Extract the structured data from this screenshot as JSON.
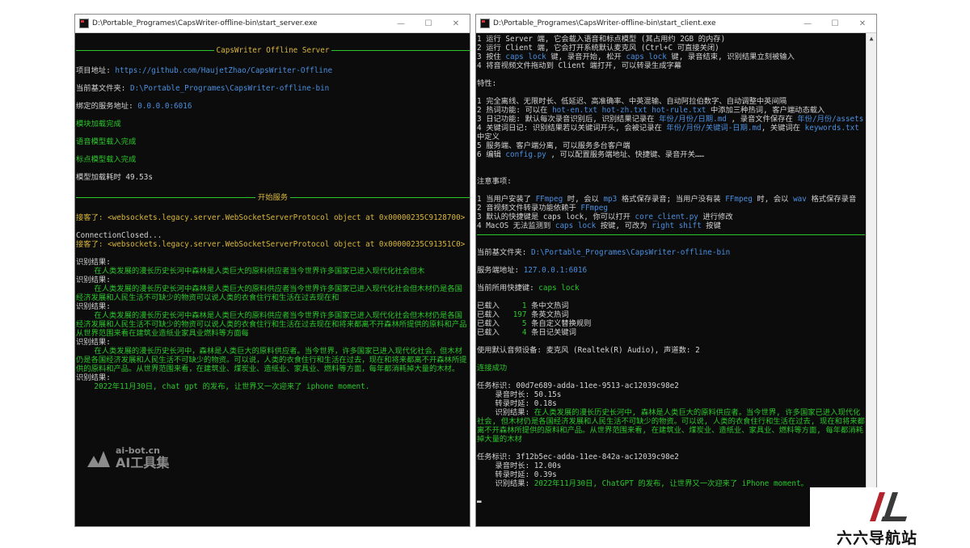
{
  "server_window": {
    "title": "D:\\Portable_Programes\\CapsWriter-offline-bin\\start_server.exe",
    "lines": [
      {
        "t": "gap"
      },
      {
        "t": "rule",
        "text": "CapsWriter Offline Server",
        "c": "y"
      },
      {
        "t": "gap"
      },
      {
        "t": "line",
        "segs": [
          {
            "text": "项目地址: ",
            "c": "w"
          },
          {
            "text": "https://github.com/HaujetZhao/CapsWriter-Offline",
            "c": "b"
          }
        ]
      },
      {
        "t": "gap"
      },
      {
        "t": "line",
        "segs": [
          {
            "text": "当前基文件夹: ",
            "c": "w"
          },
          {
            "text": "D:\\Portable_Programes\\CapsWriter-offline-bin",
            "c": "b"
          }
        ]
      },
      {
        "t": "gap"
      },
      {
        "t": "line",
        "segs": [
          {
            "text": "绑定的服务地址: ",
            "c": "w"
          },
          {
            "text": "0.0.0.0:6016",
            "c": "b"
          }
        ]
      },
      {
        "t": "gap"
      },
      {
        "t": "line",
        "segs": [
          {
            "text": "模块加载完成",
            "c": "g"
          }
        ]
      },
      {
        "t": "gap"
      },
      {
        "t": "line",
        "segs": [
          {
            "text": "语音模型载入完成",
            "c": "g"
          }
        ]
      },
      {
        "t": "gap"
      },
      {
        "t": "line",
        "segs": [
          {
            "text": "标点模型载入完成",
            "c": "g"
          }
        ]
      },
      {
        "t": "gap"
      },
      {
        "t": "line",
        "segs": [
          {
            "text": "模型加载耗时 49.53s",
            "c": "w"
          }
        ]
      },
      {
        "t": "gap"
      },
      {
        "t": "rule",
        "text": "开始服务",
        "c": "y"
      },
      {
        "t": "gap"
      },
      {
        "t": "line",
        "segs": [
          {
            "text": "接客了: <websockets.legacy.server.WebSocketServerProtocol object at 0x00000235C9128700>",
            "c": "y"
          }
        ]
      },
      {
        "t": "gap"
      },
      {
        "t": "line",
        "segs": [
          {
            "text": "ConnectionClosed...",
            "c": "w"
          }
        ]
      },
      {
        "t": "line",
        "segs": [
          {
            "text": "接客了: <websockets.legacy.server.WebSocketServerProtocol object at 0x00000235C91351C0>",
            "c": "y"
          }
        ]
      },
      {
        "t": "gap"
      },
      {
        "t": "line",
        "segs": [
          {
            "text": "识别结果:",
            "c": "w"
          }
        ]
      },
      {
        "t": "line",
        "segs": [
          {
            "text": "    在人类发展的漫长历史长河中森林是人类巨大的原料供应者当今世界许多国家已进入现代化社会但木",
            "c": "g"
          }
        ]
      },
      {
        "t": "line",
        "segs": [
          {
            "text": "识别结果:",
            "c": "w"
          }
        ]
      },
      {
        "t": "line",
        "segs": [
          {
            "text": "    在人类发展的漫长历史长河中森林是人类巨大的原料供应者当今世界许多国家已进入现代化社会但木材仍是各国经济发展和人民生活不可缺少的物资可以说人类的衣食住行和生活在过去现在和",
            "c": "g"
          }
        ]
      },
      {
        "t": "line",
        "segs": [
          {
            "text": "识别结果:",
            "c": "w"
          }
        ]
      },
      {
        "t": "line",
        "segs": [
          {
            "text": "    在人类发展的漫长历史长河中森林是人类巨大的原料供应者当今世界许多国家已进入现代化社会但木材仍是各国经济发展和人民生活不可缺少的物资可以说人类的衣食住行和生活在过去现在和将来都离不开森林所提供的原料和产品从世界范围来看在建筑业造纸业家具业燃料等方面每",
            "c": "g"
          }
        ]
      },
      {
        "t": "line",
        "segs": [
          {
            "text": "识别结果:",
            "c": "w"
          }
        ]
      },
      {
        "t": "line",
        "segs": [
          {
            "text": "    在人类发展的漫长历史长河中，森林是人类巨大的原料供应者。当今世界，许多国家已进入现代化社会，但木材仍是各国经济发展和人民生活不可缺少的物资。可以说，人类的衣食住行和生活在过去，现在和将来都离不开森林所提供的原料和产品。从世界范围来看，在建筑业、煤炭业、造纸业、家具业、燃料等方面，每年都消耗掉大量的木材。",
            "c": "g"
          }
        ]
      },
      {
        "t": "line",
        "segs": [
          {
            "text": "识别结果:",
            "c": "w"
          }
        ]
      },
      {
        "t": "line",
        "segs": [
          {
            "text": "    2022年11月30日, chat gpt 的发布, 让世界又一次迎来了 iphone moment.",
            "c": "g"
          }
        ]
      }
    ]
  },
  "client_window": {
    "title": "D:\\Portable_Programes\\CapsWriter-offline-bin\\start_client.exe",
    "lines": [
      {
        "t": "line",
        "segs": [
          {
            "text": "1 运行 Server 端, 它会载入语音和标点模型 (其占用约 2GB 的内存)",
            "c": "w"
          }
        ]
      },
      {
        "t": "line",
        "segs": [
          {
            "text": "2 运行 Client 端, 它会打开系统默认麦克风 (Ctrl+C 可直接关闭)",
            "c": "w"
          }
        ]
      },
      {
        "t": "line",
        "segs": [
          {
            "text": "3 按住 ",
            "c": "w"
          },
          {
            "text": "caps lock",
            "c": "b"
          },
          {
            "text": " 键, 录音开始, 松开 ",
            "c": "w"
          },
          {
            "text": "caps lock",
            "c": "b"
          },
          {
            "text": " 键, 录音结束, 识别结果立刻被输入",
            "c": "w"
          }
        ]
      },
      {
        "t": "line",
        "segs": [
          {
            "text": "4 将音视频文件拖动到 Client 端打开, 可以转录生成字幕",
            "c": "w"
          }
        ]
      },
      {
        "t": "gap"
      },
      {
        "t": "line",
        "segs": [
          {
            "text": "特性:",
            "c": "w"
          }
        ]
      },
      {
        "t": "gap"
      },
      {
        "t": "line",
        "segs": [
          {
            "text": "1 完全离线、无限时长、低延迟、高准确率、中英混输、自动阿拉伯数字、自动调整中英间隔",
            "c": "w"
          }
        ]
      },
      {
        "t": "line",
        "segs": [
          {
            "text": "2 热词功能: 可以在 ",
            "c": "w"
          },
          {
            "text": "hot-en.txt hot-zh.txt hot-rule.txt",
            "c": "b"
          },
          {
            "text": " 中添加三种热词, 客户端动态载入",
            "c": "w"
          }
        ]
      },
      {
        "t": "line",
        "segs": [
          {
            "text": "3 日记功能: 默认每次录音识别后, 识别结果记录在 ",
            "c": "w"
          },
          {
            "text": "年份/月份/日期.md",
            "c": "b"
          },
          {
            "text": " , 录音文件保存在 ",
            "c": "w"
          },
          {
            "text": "年份/月份/assets",
            "c": "b"
          }
        ]
      },
      {
        "t": "line",
        "segs": [
          {
            "text": "4 关键词日记: 识别结果若以关键词开头, 会被记录在 ",
            "c": "w"
          },
          {
            "text": "年份/月份/关键词-日期.md",
            "c": "b"
          },
          {
            "text": ", 关键词在 ",
            "c": "w"
          },
          {
            "text": "keywords.txt",
            "c": "b"
          },
          {
            "text": " 中定义",
            "c": "w"
          }
        ]
      },
      {
        "t": "line",
        "segs": [
          {
            "text": "5 服务端、客户端分离, 可以服务多台客户端",
            "c": "w"
          }
        ]
      },
      {
        "t": "line",
        "segs": [
          {
            "text": "6 编辑 ",
            "c": "w"
          },
          {
            "text": "config.py",
            "c": "b"
          },
          {
            "text": " , 可以配置服务端地址、快捷键、录音开关……",
            "c": "w"
          }
        ]
      },
      {
        "t": "gap2"
      },
      {
        "t": "line",
        "segs": [
          {
            "text": "注意事项:",
            "c": "w"
          }
        ]
      },
      {
        "t": "gap"
      },
      {
        "t": "line",
        "segs": [
          {
            "text": "1 当用户安装了 ",
            "c": "w"
          },
          {
            "text": "FFmpeg",
            "c": "b"
          },
          {
            "text": " 时, 会以 ",
            "c": "w"
          },
          {
            "text": "mp3",
            "c": "b"
          },
          {
            "text": " 格式保存录音; 当用户没有装 ",
            "c": "w"
          },
          {
            "text": "FFmpeg",
            "c": "b"
          },
          {
            "text": " 时, 会以 ",
            "c": "w"
          },
          {
            "text": "wav",
            "c": "b"
          },
          {
            "text": " 格式保存录音",
            "c": "w"
          }
        ]
      },
      {
        "t": "line",
        "segs": [
          {
            "text": "2 音视频文件转录功能依赖于 ",
            "c": "w"
          },
          {
            "text": "FFmpeg",
            "c": "b"
          }
        ]
      },
      {
        "t": "line",
        "segs": [
          {
            "text": "3 默认的快捷键是 caps lock, 你可以打开 ",
            "c": "w"
          },
          {
            "text": "core_client.py",
            "c": "b"
          },
          {
            "text": " 进行修改",
            "c": "w"
          }
        ]
      },
      {
        "t": "line",
        "segs": [
          {
            "text": "4 MacOS 无法监测到 ",
            "c": "w"
          },
          {
            "text": "caps lock",
            "c": "b"
          },
          {
            "text": " 按键, 可改为 ",
            "c": "w"
          },
          {
            "text": "right shift",
            "c": "b"
          },
          {
            "text": " 按键",
            "c": "w"
          }
        ]
      },
      {
        "t": "hr"
      },
      {
        "t": "gap"
      },
      {
        "t": "line",
        "segs": [
          {
            "text": "当前基文件夹: ",
            "c": "w"
          },
          {
            "text": "D:\\Portable_Programes\\CapsWriter-offline-bin",
            "c": "b"
          }
        ]
      },
      {
        "t": "gap"
      },
      {
        "t": "line",
        "segs": [
          {
            "text": "服务端地址: ",
            "c": "w"
          },
          {
            "text": "127.0.0.1:6016",
            "c": "b"
          }
        ]
      },
      {
        "t": "gap"
      },
      {
        "t": "line",
        "segs": [
          {
            "text": "当前所用快捷键: ",
            "c": "w"
          },
          {
            "text": "caps lock",
            "c": "g"
          }
        ]
      },
      {
        "t": "gap"
      },
      {
        "t": "line",
        "segs": [
          {
            "text": "已载入 ",
            "c": "w"
          },
          {
            "text": "    1",
            "c": "g"
          },
          {
            "text": " 条中文热词",
            "c": "w"
          }
        ]
      },
      {
        "t": "line",
        "segs": [
          {
            "text": "已载入 ",
            "c": "w"
          },
          {
            "text": "  197",
            "c": "g"
          },
          {
            "text": " 条英文热词",
            "c": "w"
          }
        ]
      },
      {
        "t": "line",
        "segs": [
          {
            "text": "已载入 ",
            "c": "w"
          },
          {
            "text": "    5",
            "c": "g"
          },
          {
            "text": " 条自定义替换规则",
            "c": "w"
          }
        ]
      },
      {
        "t": "line",
        "segs": [
          {
            "text": "已载入 ",
            "c": "w"
          },
          {
            "text": "    4",
            "c": "g"
          },
          {
            "text": " 条日记关键词",
            "c": "w"
          }
        ]
      },
      {
        "t": "gap"
      },
      {
        "t": "line",
        "segs": [
          {
            "text": "使用默认音频设备: 麦克风 (Realtek(R) Audio), 声道数: 2",
            "c": "w"
          }
        ]
      },
      {
        "t": "gap"
      },
      {
        "t": "line",
        "segs": [
          {
            "text": "连接成功",
            "c": "g"
          }
        ]
      },
      {
        "t": "gap"
      },
      {
        "t": "line",
        "segs": [
          {
            "text": "任务标识: 00d7e689-adda-11ee-9513-ac12039c98e2",
            "c": "w"
          }
        ]
      },
      {
        "t": "line",
        "segs": [
          {
            "text": "    录音时长: 50.15s",
            "c": "w"
          }
        ]
      },
      {
        "t": "line",
        "segs": [
          {
            "text": "    转录时延: 0.18s",
            "c": "w"
          }
        ]
      },
      {
        "t": "line",
        "segs": [
          {
            "text": "    识别结果: ",
            "c": "w"
          },
          {
            "text": "在人类发展的漫长历史长河中, 森林是人类巨大的原料供应者。当今世界, 许多国家已进入现代化社会, 但木材仍是各国经济发展和人民生活不可缺少的物资。可以说, 人类的衣食住行和生活在过去, 现在和将来都离不开森林所提供的原料和产品。从世界范围来看, 在建筑业、煤炭业、造纸业、家具业、燃料等方面, 每年都消耗掉大量的木材",
            "c": "g"
          }
        ]
      },
      {
        "t": "gap"
      },
      {
        "t": "line",
        "segs": [
          {
            "text": "任务标识: 3f12b5ec-adda-11ee-842a-ac12039c98e2",
            "c": "w"
          }
        ]
      },
      {
        "t": "line",
        "segs": [
          {
            "text": "    录音时长: 12.00s",
            "c": "w"
          }
        ]
      },
      {
        "t": "line",
        "segs": [
          {
            "text": "    转录时延: 0.39s",
            "c": "w"
          }
        ]
      },
      {
        "t": "line",
        "segs": [
          {
            "text": "    识别结果: ",
            "c": "w"
          },
          {
            "text": "2022年11月30日, ChatGPT 的发布, 让世界又一次迎来了 iPhone moment。",
            "c": "g"
          }
        ]
      },
      {
        "t": "gap"
      },
      {
        "t": "line",
        "segs": [
          {
            "text": "▬",
            "c": "w"
          }
        ]
      }
    ]
  },
  "watermark_left": {
    "line1": "ai-bot.cn",
    "line2": "AI工具集"
  },
  "watermark_right": {
    "label": "六六导航站"
  },
  "colors": {
    "white": "#d4d4d4",
    "green": "#2bc82b",
    "yellow": "#d9b73c",
    "blue": "#4a8fe0",
    "logo_red": "#b3242c",
    "logo_dark": "#3a3a3a"
  }
}
